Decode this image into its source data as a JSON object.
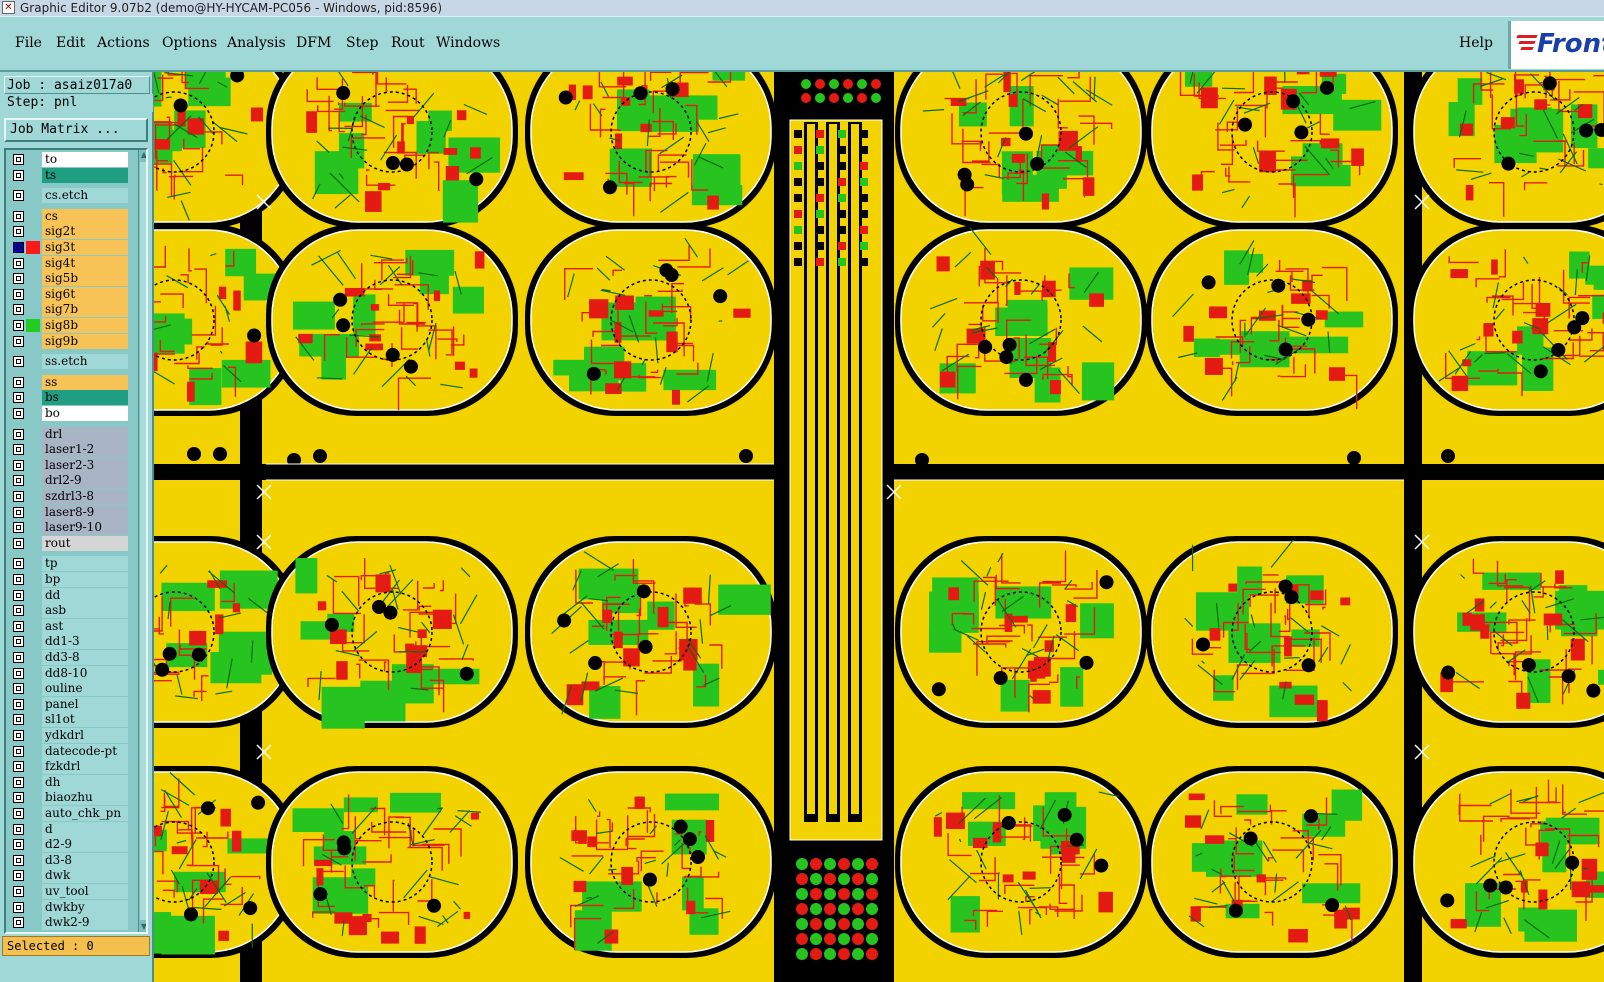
{
  "window": {
    "title": "Graphic Editor 9.07b2 (demo@HY-HYCAM-PC056 - Windows, pid:8596)"
  },
  "menu": {
    "items": [
      "File",
      "Edit",
      "Actions",
      "Options",
      "Analysis",
      "DFM",
      "Step",
      "Rout",
      "Windows"
    ],
    "help": "Help"
  },
  "logo": {
    "text": "Front"
  },
  "sidebar": {
    "job_label": "Job : asaiz017a0",
    "step_label": "Step: pnl",
    "job_matrix_button": "Job Matrix ...",
    "selected_label": "Selected : 0"
  },
  "layers": [
    {
      "name": "to",
      "bg": "#ffffff",
      "swatch": ""
    },
    {
      "name": "ts",
      "bg": "#1f9e82",
      "swatch": ""
    },
    {
      "name": "cs.etch",
      "bg": "#9fd8d6",
      "swatch": "",
      "gap": true
    },
    {
      "name": "cs",
      "bg": "#f7c356",
      "swatch": "",
      "gap": true
    },
    {
      "name": "sig2t",
      "bg": "#f7c356",
      "swatch": ""
    },
    {
      "name": "sig3t",
      "bg": "#f7c356",
      "swatch": "#ff1a1a",
      "cbcolor": "#0000cc"
    },
    {
      "name": "sig4t",
      "bg": "#f7c356",
      "swatch": ""
    },
    {
      "name": "sig5b",
      "bg": "#f7c356",
      "swatch": ""
    },
    {
      "name": "sig6t",
      "bg": "#f7c356",
      "swatch": ""
    },
    {
      "name": "sig7b",
      "bg": "#f7c356",
      "swatch": ""
    },
    {
      "name": "sig8b",
      "bg": "#f7c356",
      "swatch": "#22cc22"
    },
    {
      "name": "sig9b",
      "bg": "#f7c356",
      "swatch": ""
    },
    {
      "name": "ss.etch",
      "bg": "#9fd8d6",
      "swatch": "",
      "gap": true
    },
    {
      "name": "ss",
      "bg": "#f7c356",
      "swatch": "",
      "gap": true
    },
    {
      "name": "bs",
      "bg": "#1f9e82",
      "swatch": ""
    },
    {
      "name": "bo",
      "bg": "#ffffff",
      "swatch": ""
    },
    {
      "name": "drl",
      "bg": "#a9b4c4",
      "swatch": "",
      "gap": true
    },
    {
      "name": "laser1-2",
      "bg": "#a9b4c4",
      "swatch": ""
    },
    {
      "name": "laser2-3",
      "bg": "#a9b4c4",
      "swatch": ""
    },
    {
      "name": "drl2-9",
      "bg": "#a9b4c4",
      "swatch": ""
    },
    {
      "name": "szdrl3-8",
      "bg": "#a9b4c4",
      "swatch": ""
    },
    {
      "name": "laser8-9",
      "bg": "#a9b4c4",
      "swatch": ""
    },
    {
      "name": "laser9-10",
      "bg": "#a9b4c4",
      "swatch": ""
    },
    {
      "name": "rout",
      "bg": "#d6d6d6",
      "swatch": ""
    },
    {
      "name": "tp",
      "bg": "#9fd8d6",
      "swatch": "",
      "gap": true
    },
    {
      "name": "bp",
      "bg": "#9fd8d6",
      "swatch": ""
    },
    {
      "name": "dd",
      "bg": "#9fd8d6",
      "swatch": ""
    },
    {
      "name": "asb",
      "bg": "#9fd8d6",
      "swatch": ""
    },
    {
      "name": "ast",
      "bg": "#9fd8d6",
      "swatch": ""
    },
    {
      "name": "dd1-3",
      "bg": "#9fd8d6",
      "swatch": ""
    },
    {
      "name": "dd3-8",
      "bg": "#9fd8d6",
      "swatch": ""
    },
    {
      "name": "dd8-10",
      "bg": "#9fd8d6",
      "swatch": ""
    },
    {
      "name": "ouline",
      "bg": "#9fd8d6",
      "swatch": ""
    },
    {
      "name": "panel",
      "bg": "#9fd8d6",
      "swatch": ""
    },
    {
      "name": "sl1ot",
      "bg": "#9fd8d6",
      "swatch": ""
    },
    {
      "name": "ydkdrl",
      "bg": "#9fd8d6",
      "swatch": ""
    },
    {
      "name": "datecode-pt",
      "bg": "#9fd8d6",
      "swatch": ""
    },
    {
      "name": "fzkdrl",
      "bg": "#9fd8d6",
      "swatch": ""
    },
    {
      "name": "dh",
      "bg": "#9fd8d6",
      "swatch": ""
    },
    {
      "name": "biaozhu",
      "bg": "#9fd8d6",
      "swatch": ""
    },
    {
      "name": "auto_chk_pn",
      "bg": "#9fd8d6",
      "swatch": ""
    },
    {
      "name": "d",
      "bg": "#9fd8d6",
      "swatch": ""
    },
    {
      "name": "d2-9",
      "bg": "#9fd8d6",
      "swatch": ""
    },
    {
      "name": "d3-8",
      "bg": "#9fd8d6",
      "swatch": ""
    },
    {
      "name": "dwk",
      "bg": "#9fd8d6",
      "swatch": ""
    },
    {
      "name": "uv_tool",
      "bg": "#9fd8d6",
      "swatch": ""
    },
    {
      "name": "dwkby",
      "bg": "#9fd8d6",
      "swatch": ""
    },
    {
      "name": "dwk2-9",
      "bg": "#9fd8d6",
      "swatch": ""
    }
  ],
  "colors": {
    "copper": "#f2d300",
    "signal_red": "#e41b12",
    "signal_green": "#27c420",
    "background": "#000000",
    "ui_teal": "#9fd8d6"
  }
}
